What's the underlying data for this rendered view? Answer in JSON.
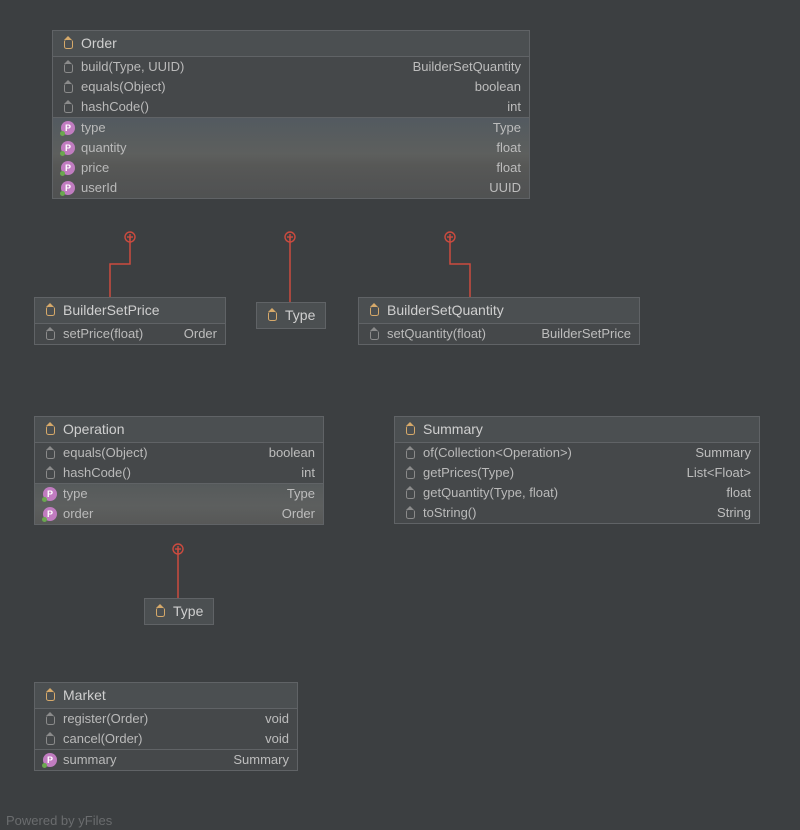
{
  "classes": {
    "order": {
      "title": "Order",
      "methods": [
        {
          "name": "build(Type, UUID)",
          "type": "BuilderSetQuantity"
        },
        {
          "name": "equals(Object)",
          "type": "boolean"
        },
        {
          "name": "hashCode()",
          "type": "int"
        }
      ],
      "properties": [
        {
          "name": "type",
          "type": "Type"
        },
        {
          "name": "quantity",
          "type": "float"
        },
        {
          "name": "price",
          "type": "float"
        },
        {
          "name": "userId",
          "type": "UUID"
        }
      ]
    },
    "builderSetPrice": {
      "title": "BuilderSetPrice",
      "methods": [
        {
          "name": "setPrice(float)",
          "type": "Order"
        }
      ]
    },
    "typeOrder": {
      "title": "Type"
    },
    "builderSetQuantity": {
      "title": "BuilderSetQuantity",
      "methods": [
        {
          "name": "setQuantity(float)",
          "type": "BuilderSetPrice"
        }
      ]
    },
    "operation": {
      "title": "Operation",
      "methods": [
        {
          "name": "equals(Object)",
          "type": "boolean"
        },
        {
          "name": "hashCode()",
          "type": "int"
        }
      ],
      "properties": [
        {
          "name": "type",
          "type": "Type"
        },
        {
          "name": "order",
          "type": "Order"
        }
      ]
    },
    "summary": {
      "title": "Summary",
      "methods": [
        {
          "name": "of(Collection<Operation>)",
          "type": "Summary"
        },
        {
          "name": "getPrices(Type)",
          "type": "List<Float>"
        },
        {
          "name": "getQuantity(Type, float)",
          "type": "float"
        },
        {
          "name": "toString()",
          "type": "String"
        }
      ]
    },
    "typeOperation": {
      "title": "Type"
    },
    "market": {
      "title": "Market",
      "methods": [
        {
          "name": "register(Order)",
          "type": "void"
        },
        {
          "name": "cancel(Order)",
          "type": "void"
        }
      ],
      "properties": [
        {
          "name": "summary",
          "type": "Summary"
        }
      ]
    }
  },
  "footer": "Powered by yFiles",
  "icons": {
    "propertyLetter": "P"
  }
}
